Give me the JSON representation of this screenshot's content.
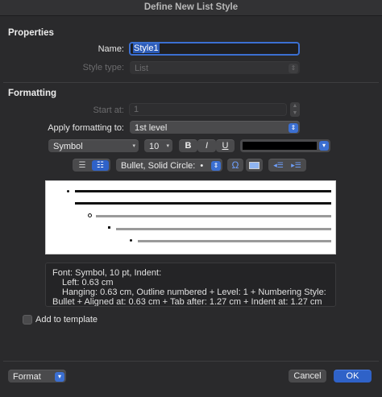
{
  "window": {
    "title": "Define New List Style"
  },
  "properties": {
    "heading": "Properties",
    "name_label": "Name:",
    "name_value": "Style1",
    "style_type_label": "Style type:",
    "style_type_value": "List"
  },
  "formatting": {
    "heading": "Formatting",
    "start_at_label": "Start at:",
    "start_at_value": "1",
    "apply_label": "Apply formatting to:",
    "apply_value": "1st level",
    "font_name": "Symbol",
    "font_size": "10",
    "bold_label": "B",
    "italic_label": "I",
    "underline_label": "U",
    "font_color": "#000000",
    "bullet_style": "Bullet, Solid Circle:",
    "bullet_char": "•",
    "symbol_icon_glyph": "Ω"
  },
  "description": {
    "line1": "Font: Symbol, 10 pt, Indent:",
    "line2": "Left:  0.63 cm",
    "line3": "Hanging:  0.63 cm, Outline numbered + Level: 1 + Numbering Style:",
    "line4": "Bullet + Aligned at:  0.63 cm + Tab after:  1.27 cm + Indent at:  1.27 cm"
  },
  "add_to_template": {
    "label": "Add to template",
    "checked": false
  },
  "footer": {
    "format_label": "Format",
    "cancel_label": "Cancel",
    "ok_label": "OK"
  },
  "colors": {
    "accent": "#3b6fd1",
    "ok_button": "#2f62c8",
    "background": "#2a2a2c"
  }
}
